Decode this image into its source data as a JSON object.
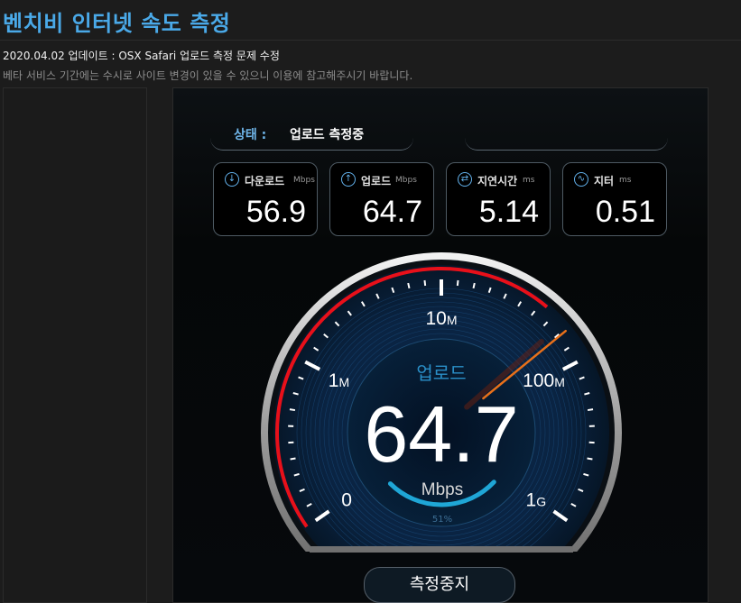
{
  "page": {
    "title": "벤치비 인터넷 속도 측정",
    "update_line": "2020.04.02 업데이트 : OSX Safari 업로드 측정 문제 수정",
    "notice_line": "베타 서비스 기간에는 수시로 사이트 변경이 있을 수 있으니 이용에 참고해주시기 바랍니다."
  },
  "status": {
    "label": "상태 :",
    "value": "업로드 측정중"
  },
  "stats": [
    {
      "label": "다운로드",
      "unit": "Mbps",
      "value": "56.9",
      "icon": "download-icon"
    },
    {
      "label": "업로드",
      "unit": "Mbps",
      "value": "64.7",
      "icon": "upload-icon"
    },
    {
      "label": "지연시간",
      "unit": "ms",
      "value": "5.14",
      "icon": "latency-icon"
    },
    {
      "label": "지터",
      "unit": "ms",
      "value": "0.51",
      "icon": "jitter-icon"
    }
  ],
  "gauge": {
    "mode_label": "업로드",
    "value": "64.7",
    "unit": "Mbps",
    "progress_label": "51%",
    "progress_fraction": 0.51,
    "scale_labels": [
      {
        "num": "0",
        "suffix": ""
      },
      {
        "num": "1",
        "suffix": "M"
      },
      {
        "num": "10",
        "suffix": "M"
      },
      {
        "num": "100",
        "suffix": "M"
      },
      {
        "num": "1",
        "suffix": "G"
      }
    ],
    "accent_color": "#e8101a",
    "progress_color": "#1fa6d6"
  },
  "controls": {
    "stop_label": "측정중지"
  }
}
